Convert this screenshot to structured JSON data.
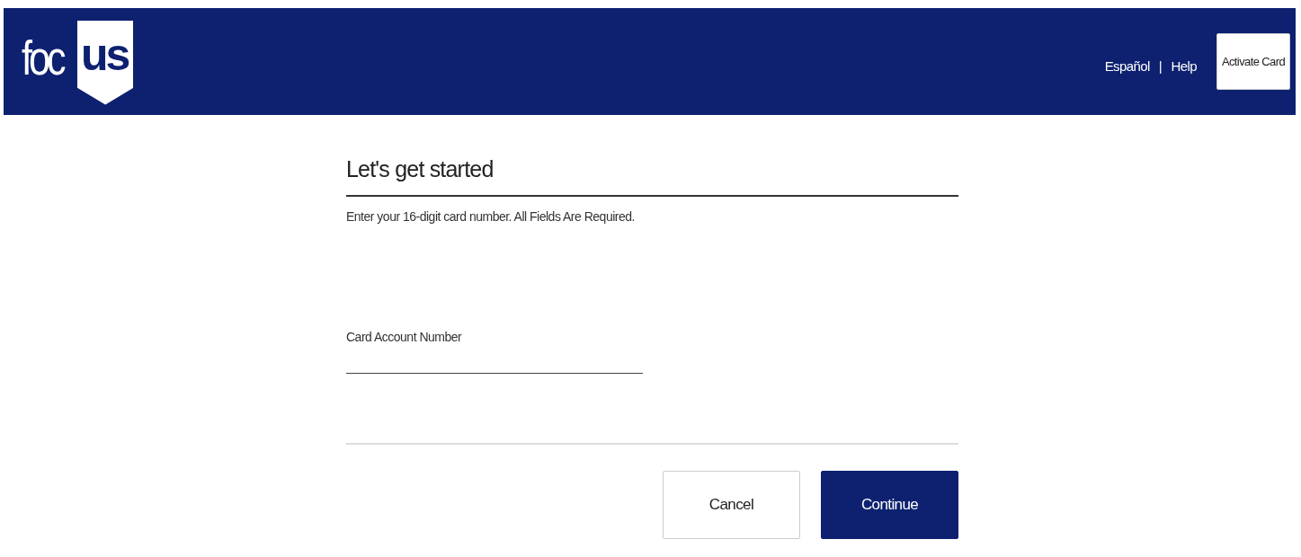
{
  "header": {
    "logo": {
      "light": "foc",
      "bold": "us"
    },
    "links": [
      {
        "label": "Español"
      },
      {
        "label": "Help"
      }
    ],
    "separator": "|",
    "button": "Activate Card"
  },
  "form": {
    "title": "Let's get started",
    "instructions": "Enter your 16-digit card number. All Fields Are Required.",
    "field": {
      "label": "Card Account Number"
    },
    "buttons": [
      {
        "label": "Cancel",
        "kind": "secondary"
      },
      {
        "label": "Continue",
        "kind": "primary"
      }
    ]
  }
}
